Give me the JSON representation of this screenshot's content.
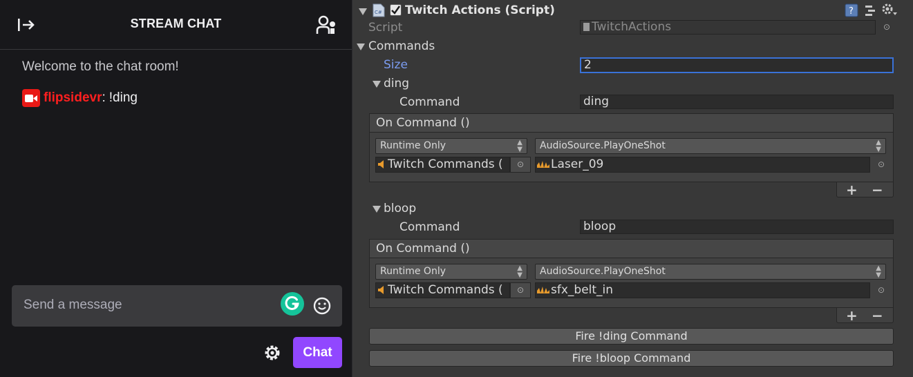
{
  "chat": {
    "title": "STREAM CHAT",
    "welcome": "Welcome to the chat room!",
    "message": {
      "user": "flipsidevr",
      "separator": ":",
      "text": "!ding"
    },
    "input_placeholder": "Send a message",
    "send_label": "Chat",
    "colors": {
      "accent": "#9147ff",
      "username": "#ff1f1f",
      "badge": "#e91916",
      "grammarly": "#15c39a"
    },
    "icons": [
      "collapse-icon",
      "users-icon",
      "grammarly-icon",
      "emote-icon",
      "settings-icon",
      "broadcaster-badge-icon"
    ]
  },
  "inspector": {
    "component_title": "Twitch Actions (Script)",
    "script_label": "Script",
    "script_value": "TwitchActions",
    "commands_label": "Commands",
    "size_label": "Size",
    "size_value": "2",
    "elements": [
      {
        "name": "ding",
        "command_label": "Command",
        "command_value": "ding",
        "event_header": "On Command ()",
        "runtime": "Runtime Only",
        "function": "AudioSource.PlayOneShot",
        "target": "Twitch Commands (",
        "argument": "Laser_09"
      },
      {
        "name": "bloop",
        "command_label": "Command",
        "command_value": "bloop",
        "event_header": "On Command ()",
        "runtime": "Runtime Only",
        "function": "AudioSource.PlayOneShot",
        "target": "Twitch Commands (",
        "argument": "sfx_belt_in"
      }
    ],
    "buttons": [
      "Fire !ding Command",
      "Fire !bloop Command"
    ],
    "plus": "+",
    "minus": "−",
    "colors": {
      "size_label": "#7b9cf0",
      "focus": "#3a72d8"
    }
  }
}
